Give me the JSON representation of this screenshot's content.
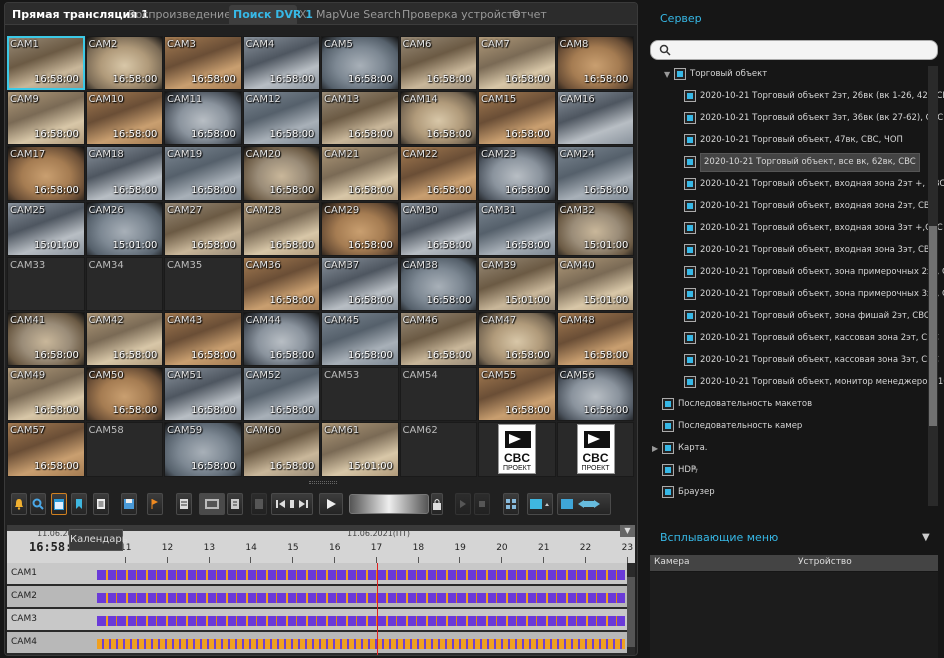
{
  "tabs": [
    "Прямая трансляция 1",
    "Воспроизведение 1",
    "Поиск DVR 1",
    "MapVue Search",
    "Проверка устройств",
    "Отчет"
  ],
  "tab_close": "X",
  "cams": [
    {
      "label": "CAM1",
      "time": "16:58:00"
    },
    {
      "label": "CAM2",
      "time": "16:58:00"
    },
    {
      "label": "CAM3",
      "time": "16:58:00"
    },
    {
      "label": "CAM4",
      "time": "16:58:00"
    },
    {
      "label": "CAM5",
      "time": "16:58:00"
    },
    {
      "label": "CAM6",
      "time": "16:58:00"
    },
    {
      "label": "CAM7",
      "time": "16:58:00"
    },
    {
      "label": "CAM8",
      "time": "16:58:00"
    },
    {
      "label": "CAM9",
      "time": "16:58:00"
    },
    {
      "label": "CAM10",
      "time": "16:58:00"
    },
    {
      "label": "CAM11",
      "time": "16:58:00"
    },
    {
      "label": "CAM12",
      "time": "16:58:00"
    },
    {
      "label": "CAM13",
      "time": "16:58:00"
    },
    {
      "label": "CAM14",
      "time": "16:58:00"
    },
    {
      "label": "CAM15",
      "time": "16:58:00"
    },
    {
      "label": "CAM16",
      "time": ""
    },
    {
      "label": "CAM17",
      "time": "16:58:00"
    },
    {
      "label": "CAM18",
      "time": "16:58:00"
    },
    {
      "label": "CAM19",
      "time": "16:58:00"
    },
    {
      "label": "CAM20",
      "time": "16:58:00"
    },
    {
      "label": "CAM21",
      "time": "16:58:00"
    },
    {
      "label": "CAM22",
      "time": "16:58:00"
    },
    {
      "label": "CAM23",
      "time": "16:58:00"
    },
    {
      "label": "CAM24",
      "time": "16:58:00"
    },
    {
      "label": "CAM25",
      "time": "15:01:00"
    },
    {
      "label": "CAM26",
      "time": "15:01:00"
    },
    {
      "label": "CAM27",
      "time": "16:58:00"
    },
    {
      "label": "CAM28",
      "time": "16:58:00"
    },
    {
      "label": "CAM29",
      "time": "16:58:00"
    },
    {
      "label": "CAM30",
      "time": "16:58:00"
    },
    {
      "label": "CAM31",
      "time": "16:58:00"
    },
    {
      "label": "CAM32",
      "time": "15:01:00"
    },
    {
      "label": "CAM33",
      "time": ""
    },
    {
      "label": "CAM34",
      "time": ""
    },
    {
      "label": "CAM35",
      "time": ""
    },
    {
      "label": "CAM36",
      "time": "16:58:00"
    },
    {
      "label": "CAM37",
      "time": "16:58:00"
    },
    {
      "label": "CAM38",
      "time": "16:58:00"
    },
    {
      "label": "CAM39",
      "time": "15:01:00"
    },
    {
      "label": "CAM40",
      "time": "15:01:00"
    },
    {
      "label": "CAM41",
      "time": "16:58:00"
    },
    {
      "label": "CAM42",
      "time": "16:58:00"
    },
    {
      "label": "CAM43",
      "time": "16:58:00"
    },
    {
      "label": "CAM44",
      "time": "16:58:00"
    },
    {
      "label": "CAM45",
      "time": "16:58:00"
    },
    {
      "label": "CAM46",
      "time": "16:58:00"
    },
    {
      "label": "CAM47",
      "time": "16:58:00"
    },
    {
      "label": "CAM48",
      "time": "16:58:00"
    },
    {
      "label": "CAM49",
      "time": "16:58:00"
    },
    {
      "label": "CAM50",
      "time": "16:58:00"
    },
    {
      "label": "CAM51",
      "time": "16:58:00"
    },
    {
      "label": "CAM52",
      "time": "16:58:00"
    },
    {
      "label": "CAM53",
      "time": ""
    },
    {
      "label": "CAM54",
      "time": ""
    },
    {
      "label": "CAM55",
      "time": "16:58:00"
    },
    {
      "label": "CAM56",
      "time": "16:58:00"
    },
    {
      "label": "CAM57",
      "time": "16:58:00"
    },
    {
      "label": "CAM58",
      "time": ""
    },
    {
      "label": "CAM59",
      "time": "16:58:00"
    },
    {
      "label": "CAM60",
      "time": "16:58:00"
    },
    {
      "label": "CAM61",
      "time": "15:01:00"
    },
    {
      "label": "CAM62",
      "time": ""
    },
    {
      "label": "",
      "time": ""
    },
    {
      "label": "",
      "time": ""
    }
  ],
  "logo": {
    "line1": "CBC",
    "line2": "ПРОЕКТ"
  },
  "timeline": {
    "date_left": "11.06.2021",
    "time": "16:58:00",
    "date_center": "11.06.2021(ПТ)",
    "ticks": [
      "11",
      "12",
      "13",
      "14",
      "15",
      "16",
      "17",
      "18",
      "19",
      "20",
      "21",
      "22",
      "23"
    ],
    "tooltip": "Календарь",
    "rows": [
      "CAM1",
      "CAM2",
      "CAM3",
      "CAM4"
    ]
  },
  "server_title": "Сервер",
  "search_placeholder": "",
  "tree": {
    "root": "Торговый объект",
    "items": [
      "2020-10-21 Торговый объект 2эт, 26вк (вк 1-26, 42), CBC",
      "2020-10-21 Торговый объект 3эт, 36вк (вк 27-62), CBC",
      "2020-10-21 Торговый объект, 47вк, CBC, ЧОП",
      "2020-10-21 Торговый объект, все вк, 62вк, CBC",
      "2020-10-21 Торговый объект, входная зона 2эт +, CBC",
      "2020-10-21 Торговый объект, входная зона 2эт, CBC",
      "2020-10-21 Торговый объект, входная зона 3эт +,CBC",
      "2020-10-21 Торговый объект, входная зона 3эт, CBC",
      "2020-10-21 Торговый объект, зона примерочных 2эт, CBC",
      "2020-10-21 Торговый объект, зона примерочных 3эт, CBC",
      "2020-10-21 Торговый объект, зона фишай 2эт, CBC",
      "2020-10-21 Торговый объект, кассовая зона 2эт, CBC",
      "2020-10-21 Торговый объект, кассовая зона 3эт, CBC",
      "2020-10-21 Торговый объект, монитор менеджеров, 16вк, CBC"
    ],
    "selected_index": 3,
    "others": [
      "Последовательность макетов",
      "Последовательность камер",
      "Карта.",
      "HDP",
      "Браузер"
    ]
  },
  "popup_title": "Всплывающие меню",
  "popup_columns": [
    "Камера",
    "Устройство"
  ]
}
